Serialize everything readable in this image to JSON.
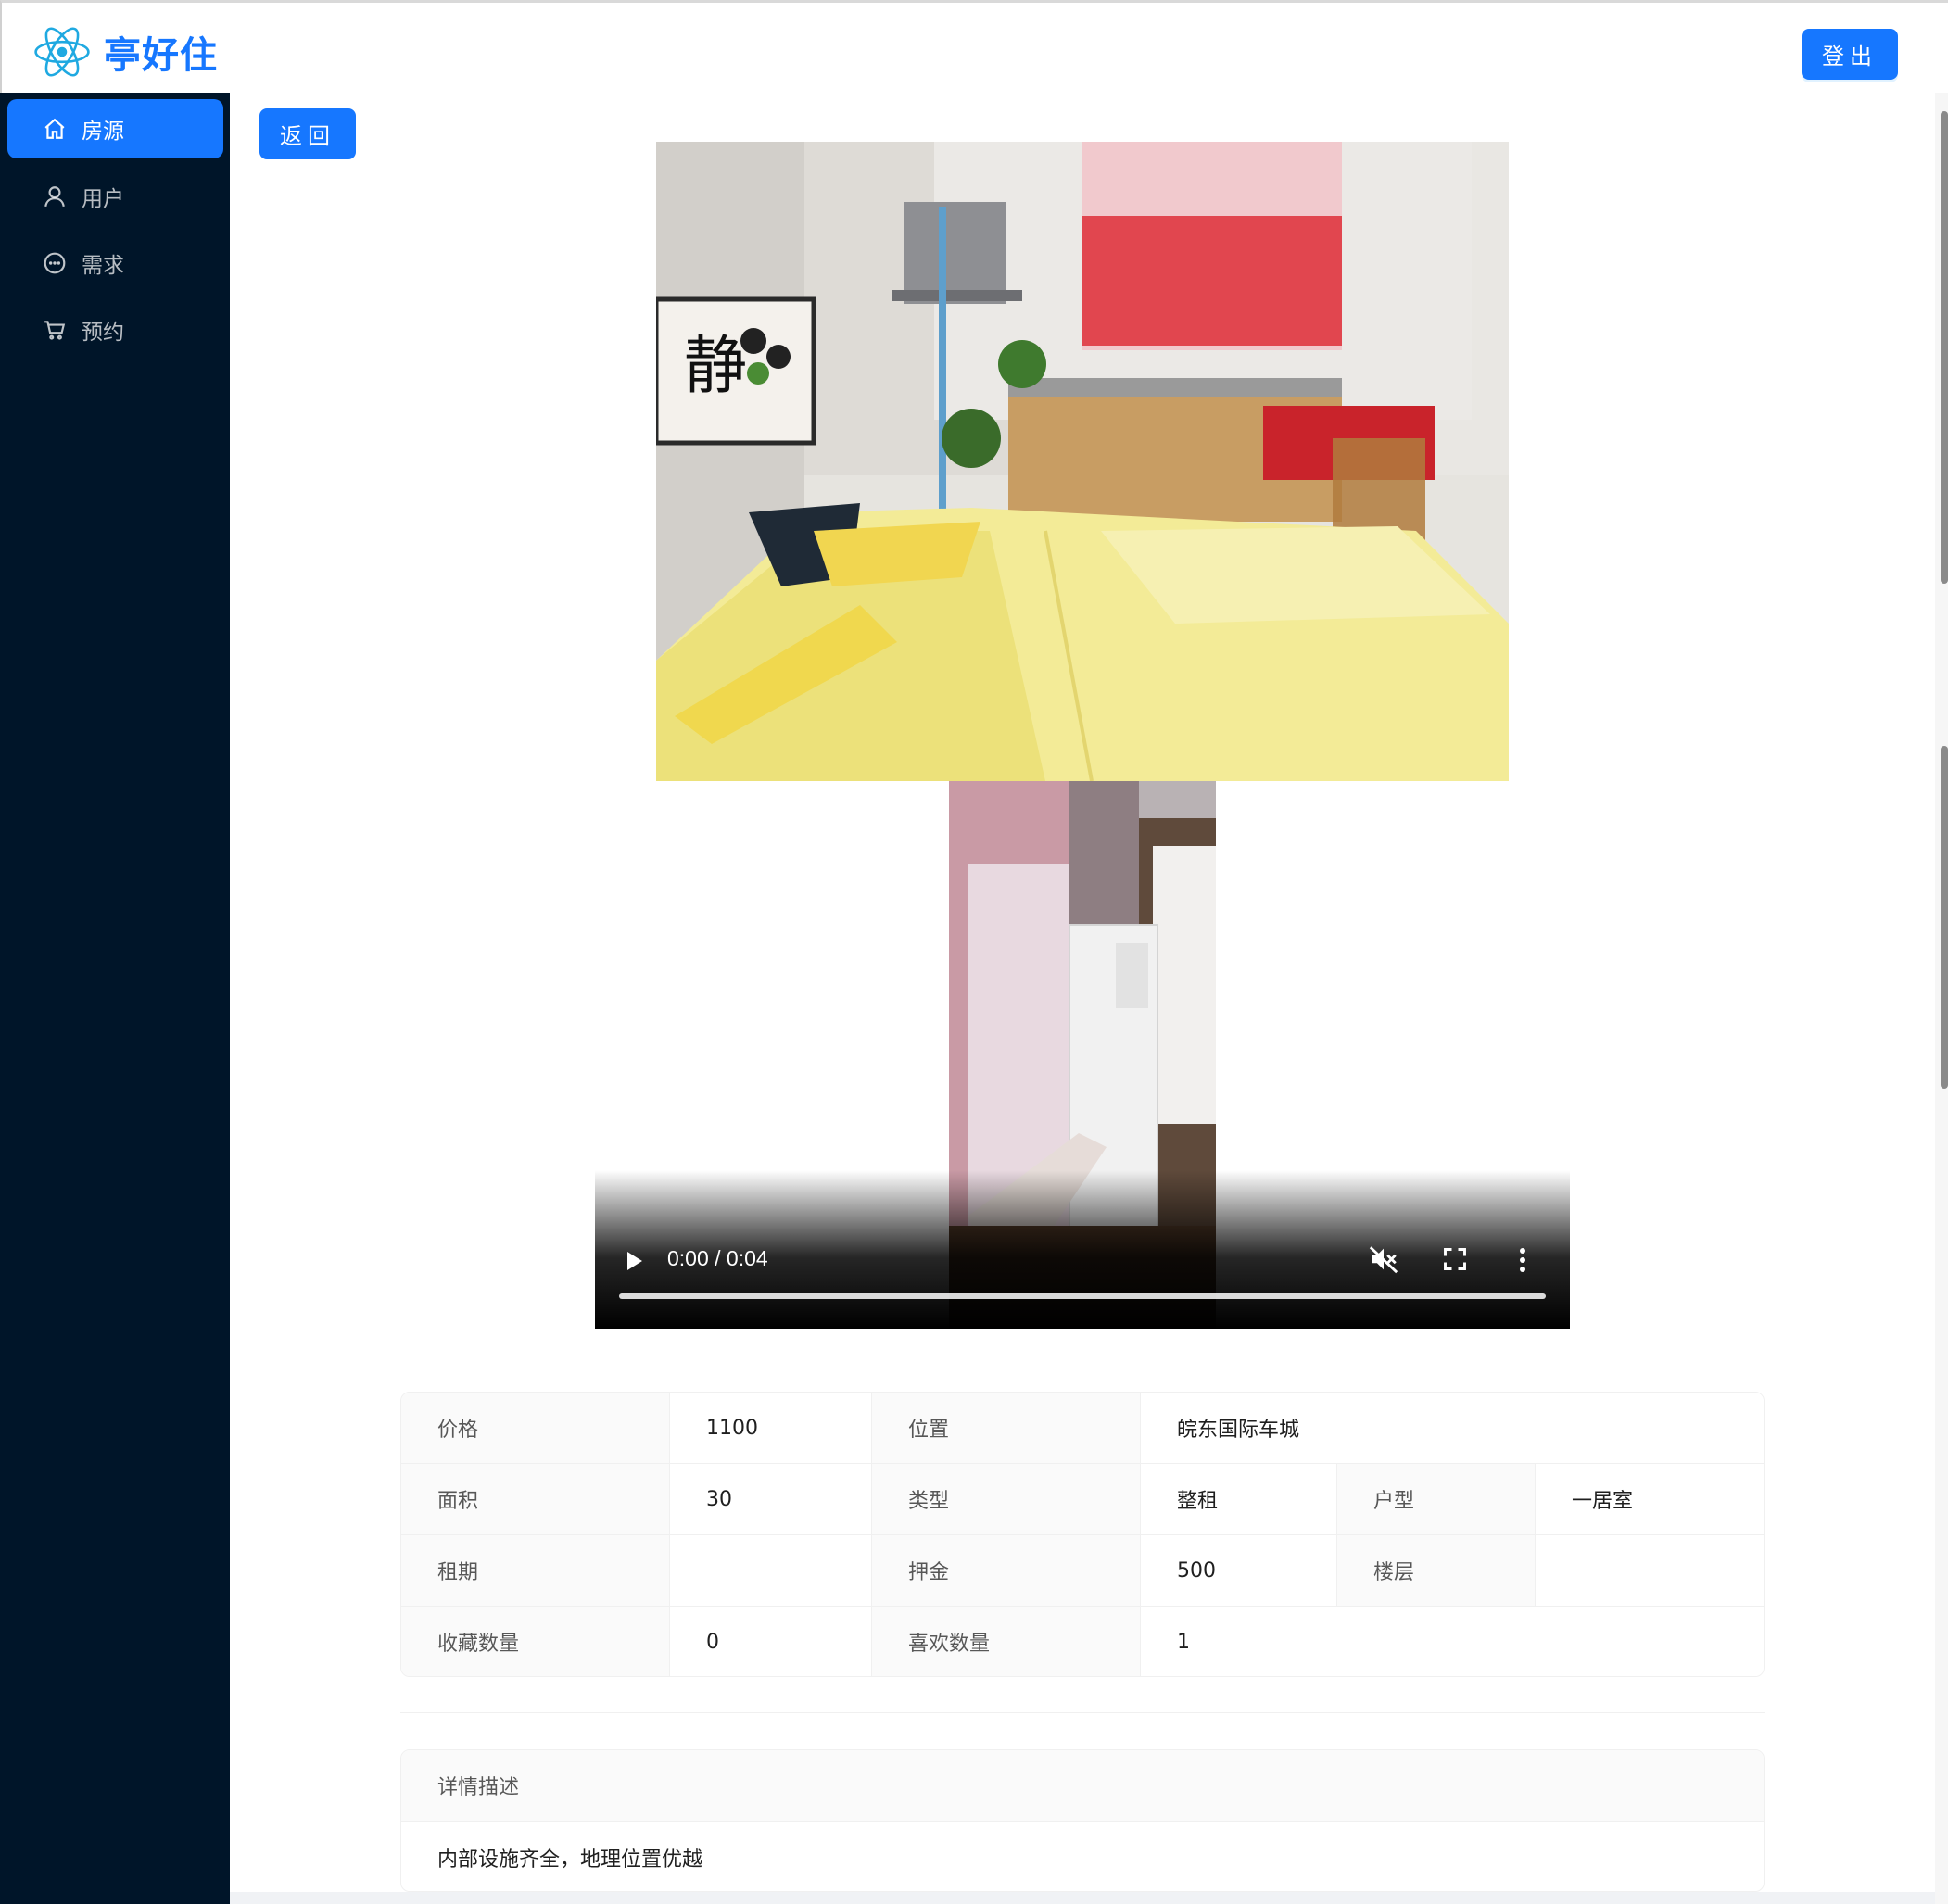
{
  "app": {
    "name": "亭好住",
    "logout_label": "登出",
    "accent": "#1677ff",
    "sidebar_bg": "#001529"
  },
  "sidebar": {
    "items": [
      {
        "label": "房源",
        "icon": "home-icon",
        "active": true
      },
      {
        "label": "用户",
        "icon": "user-icon",
        "active": false
      },
      {
        "label": "需求",
        "icon": "message-icon",
        "active": false
      },
      {
        "label": "预约",
        "icon": "cart-icon",
        "active": false
      }
    ]
  },
  "main": {
    "back_label": "返回",
    "video": {
      "time": "0:00 / 0:04",
      "progress": 0
    },
    "details": {
      "price_label": "价格",
      "price_value": "1100",
      "location_label": "位置",
      "location_value": "皖东国际车城",
      "area_label": "面积",
      "area_value": "30",
      "type_label": "类型",
      "type_value": "整租",
      "layout_label": "户型",
      "layout_value": "一居室",
      "lease_label": "租期",
      "lease_value": "",
      "deposit_label": "押金",
      "deposit_value": "500",
      "floor_label": "楼层",
      "floor_value": "",
      "favorites_label": "收藏数量",
      "favorites_value": "0",
      "likes_label": "喜欢数量",
      "likes_value": "1"
    },
    "description": {
      "title": "详情描述",
      "text": "内部设施齐全，地理位置优越"
    }
  }
}
